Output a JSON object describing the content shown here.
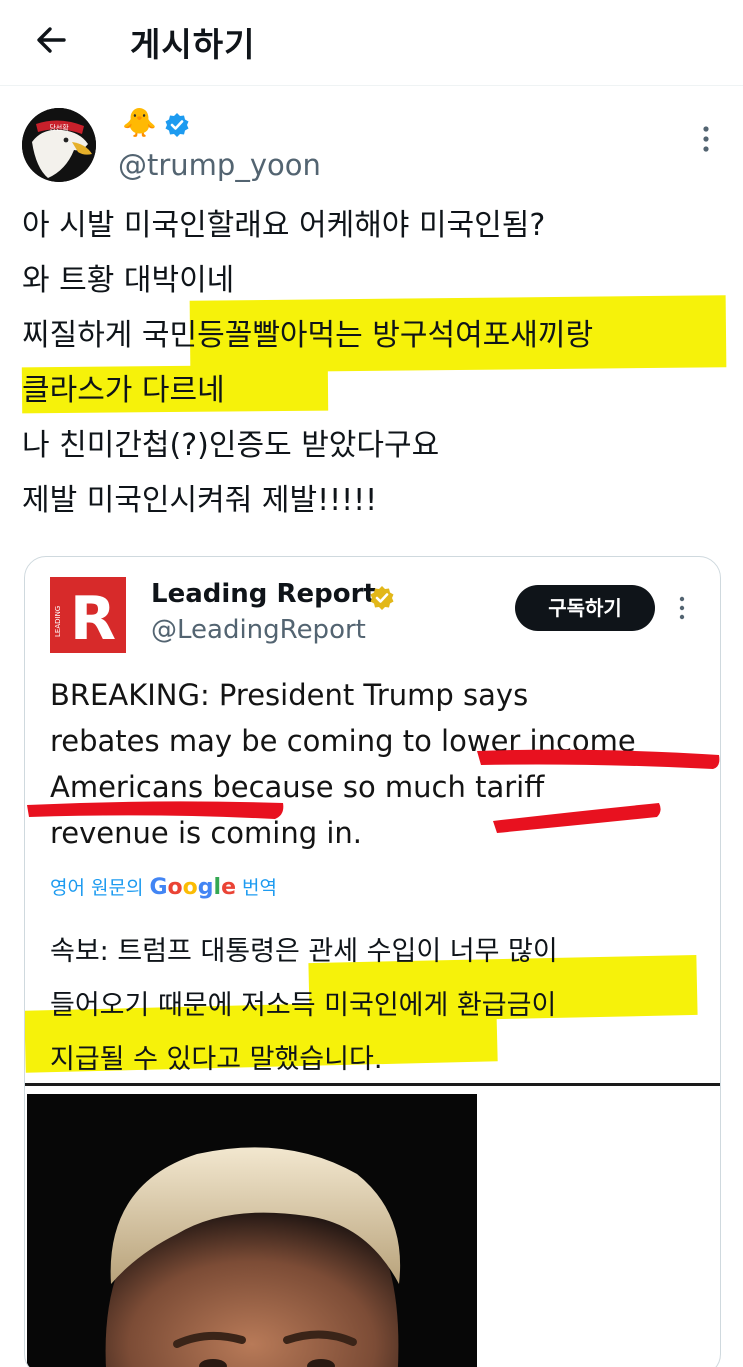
{
  "header": {
    "title": "게시하기",
    "back_icon": "arrow-left-icon"
  },
  "post": {
    "author_emoji": "🐥",
    "handle": "@trump_yoon",
    "avatar_badge": "당선확",
    "lines": [
      "아 시발 미국인할래요 어케해야 미국인됨?",
      "와 트황 대박이네",
      "찌질하게 국민등꼴빨아먹는 방구석여포새끼랑",
      "클라스가 다르네",
      "나 친미간첩(?)인증도 받았다구요",
      "제발 미국인시켜줘 제발!!!!!"
    ]
  },
  "quoted": {
    "name": "Leading Report",
    "handle": "@LeadingReport",
    "subscribe_label": "구독하기",
    "logo_letter": "R",
    "logo_side_text": "LEADING",
    "text_lines": [
      "BREAKING: President Trump says",
      "rebates may be coming to lower income",
      "Americans because so much tariff",
      "revenue is coming in."
    ],
    "translate_prefix": "영어 원문의 ",
    "translate_brand": "Google",
    "translate_suffix": " 번역",
    "translation_lines": [
      "속보: 트럼프 대통령은 관세 수입이 너무 많이",
      "들어오기 때문에 저소득 미국인에게 환급금이",
      "지급될 수 있다고 말했습니다."
    ]
  },
  "colors": {
    "highlight": "#f6f20a",
    "red_underline": "#e8111f",
    "verified_blue": "#1d9bf0",
    "verified_gold": "#e2b719",
    "brand_red": "#d72a2a"
  }
}
